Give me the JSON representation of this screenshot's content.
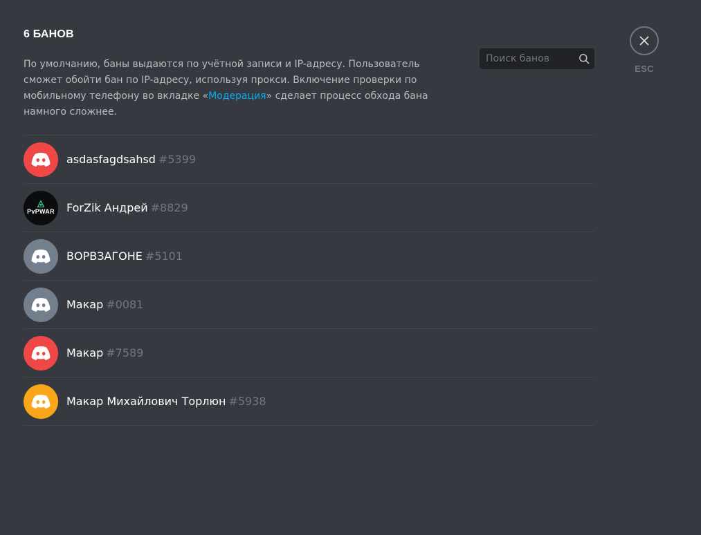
{
  "header": {
    "title": "6 БАНОВ"
  },
  "description": {
    "text_before": "По умолчанию, баны выдаются по учётной записи и IP-адресу. Пользователь сможет обойти бан по IP-адресу, используя прокси. Включение проверки по мобильному телефону во вкладке «",
    "link_text": "Модерация",
    "text_after": "» сделает процесс обхода бана намного сложнее."
  },
  "search": {
    "placeholder": "Поиск банов",
    "value": "",
    "icon": "search-icon"
  },
  "close": {
    "icon": "close-icon",
    "hint": "ESC"
  },
  "colors": {
    "background": "#36393f",
    "link": "#00b0f4",
    "avatar_red": "#f04747",
    "avatar_gray": "#747f8d",
    "avatar_yellow": "#faa61a",
    "avatar_dark": "#0b0c0e"
  },
  "bans": [
    {
      "name": "asdasfagdsahsd",
      "tag": "#5399",
      "avatar": "discord-logo-icon",
      "avatar_color": "#f04747"
    },
    {
      "name": "ForZik Андрей",
      "tag": "#8829",
      "avatar": "pvpwar-logo",
      "avatar_color": "#0b0c0e",
      "avatar_text": "PvPWAR"
    },
    {
      "name": "ВОРВЗАГОНЕ",
      "tag": "#5101",
      "avatar": "discord-logo-icon",
      "avatar_color": "#747f8d"
    },
    {
      "name": "Макар",
      "tag": "#0081",
      "avatar": "discord-logo-icon",
      "avatar_color": "#747f8d"
    },
    {
      "name": "Макар",
      "tag": "#7589",
      "avatar": "discord-logo-icon",
      "avatar_color": "#f04747"
    },
    {
      "name": "Макар Михайлович Торлюн",
      "tag": "#5938",
      "avatar": "discord-logo-icon",
      "avatar_color": "#faa61a"
    }
  ]
}
